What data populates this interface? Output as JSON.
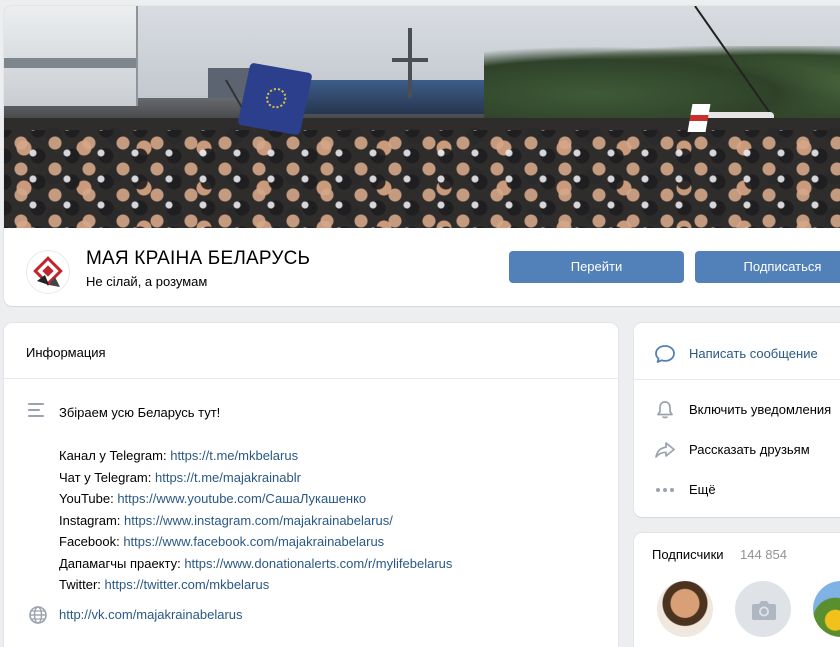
{
  "group": {
    "name": "МАЯ КРАІНА БЕЛАРУСЬ",
    "status": "Не сілай, а розумам",
    "buttons": {
      "goto": "Перейти",
      "subscribe": "Подписаться"
    }
  },
  "info": {
    "title": "Информация",
    "description": {
      "intro": "Збіраем усю Беларусь тут!",
      "links": [
        {
          "label": "Канал у Telegram: ",
          "url": "https://t.me/mkbelarus"
        },
        {
          "label": "Чат у Telegram: ",
          "url": "https://t.me/majakrainablr"
        },
        {
          "label": "YouTube: ",
          "url": "https://www.youtube.com/СашаЛукашенко"
        },
        {
          "label": "Instagram: ",
          "url": "https://www.instagram.com/majakrainabelarus/"
        },
        {
          "label": "Facebook: ",
          "url": "https://www.facebook.com/majakrainabelarus"
        },
        {
          "label": "Дапамагчы праекту: ",
          "url": "https://www.donationalerts.com/r/mylifebelarus"
        },
        {
          "label": "Twitter: ",
          "url": "https://twitter.com/mkbelarus"
        }
      ]
    },
    "website": "http://vk.com/majakrainabelarus"
  },
  "actions": {
    "write_message": "Написать сообщение",
    "notifications": "Включить уведомления",
    "share": "Рассказать друзьям",
    "more": "Ещё"
  },
  "followers": {
    "title": "Подписчики",
    "count": "144 854"
  },
  "icons": {
    "description": "description-lines-icon",
    "website": "globe-icon",
    "write": "message-bubble-icon",
    "notify": "bell-icon",
    "share": "share-arrow-icon",
    "more": "more-dots-icon",
    "camera": "camera-icon"
  },
  "colors": {
    "accent_button": "#5181b8",
    "link": "#2a5885",
    "background": "#edeef0",
    "muted": "#939393"
  }
}
